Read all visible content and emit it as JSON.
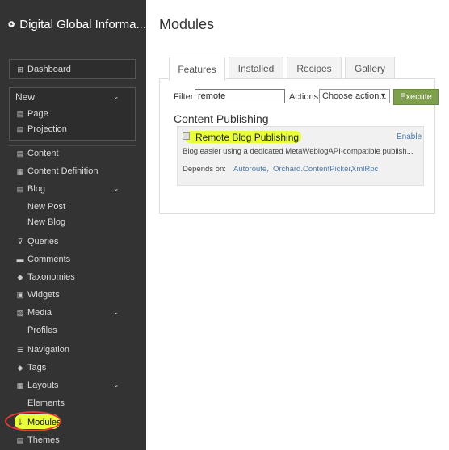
{
  "brand": {
    "title": "Digital Global Informa..."
  },
  "sidebar": {
    "dashboard": "Dashboard",
    "new": "New",
    "page": "Page",
    "projection": "Projection",
    "content": "Content",
    "content_definition": "Content Definition",
    "blog": "Blog",
    "new_post": "New Post",
    "new_blog": "New Blog",
    "queries": "Queries",
    "comments": "Comments",
    "taxonomies": "Taxonomies",
    "widgets": "Widgets",
    "media": "Media",
    "profiles": "Profiles",
    "navigation": "Navigation",
    "tags": "Tags",
    "layouts": "Layouts",
    "elements": "Elements",
    "modules": "Modules",
    "themes": "Themes"
  },
  "main": {
    "title": "Modules",
    "tabs": [
      "Features",
      "Installed",
      "Recipes",
      "Gallery"
    ],
    "filter_label": "Filter:",
    "filter_value": "remote",
    "actions_label": "Actions:",
    "actions_selected": "Choose action...",
    "execute": "Execute",
    "section": "Content Publishing",
    "module": {
      "name": "Remote Blog Publishing",
      "enable": "Enable",
      "description": "Blog easier using a dedicated MetaWeblogAPI-compatible publish...",
      "depends_label": "Depends on:",
      "depends": [
        "Autoroute,",
        "Orchard.ContentPicker,",
        "XmlRpc"
      ]
    }
  },
  "colors": {
    "sidebar": "#333333",
    "execute": "#7fa04a",
    "highlight": "#e8ff3a",
    "annotation": "#e63a3a"
  }
}
